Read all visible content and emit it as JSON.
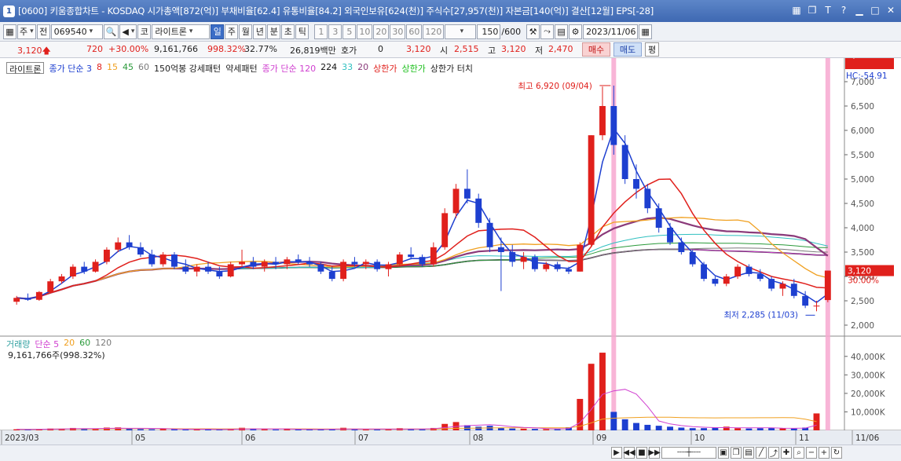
{
  "window": {
    "number": "1",
    "title": "[0600] 키움종합차트 - KOSDAQ 시가총액[872(억)] 부채비율[62.4] 유통비율[84.2] 외국인보유[624(천)] 주식수[27,957(천)] 자본금[140(억)] 결산[12월] EPS[-28]"
  },
  "toolbar": {
    "type_select": "주",
    "prev_label": "전",
    "stock_code": "069540",
    "stock_name": "라이트론",
    "stock_prefix": "코",
    "periods": [
      "일",
      "주",
      "월",
      "년",
      "분",
      "초",
      "틱"
    ],
    "active_period": "일",
    "intervals": [
      "1",
      "3",
      "5",
      "10",
      "20",
      "30",
      "60",
      "120"
    ],
    "count": "150",
    "count_total": "/600",
    "date": "2023/11/06"
  },
  "quote": {
    "price": "3,120",
    "change": "720",
    "change_pct": "+30.00%",
    "volume": "9,161,766",
    "volume_ratio": "998.32%",
    "turnover": "32.77%",
    "amount": "26,819백만",
    "hoga_label": "호가",
    "hoga_value": "0",
    "current": "3,120",
    "open_label": "시",
    "open": "2,515",
    "high_label": "고",
    "high": "3,120",
    "low_label": "저",
    "low": "2,470",
    "buy_label": "매수",
    "sell_label": "매도",
    "avg_label": "평"
  },
  "legend_price": {
    "name": "라이트론",
    "ma_label": "종가 단순",
    "ma_periods": [
      "3",
      "8",
      "15",
      "45",
      "60"
    ],
    "pattern_label": "150억봉 강세패턴",
    "weak_pattern": "약세패턴",
    "ma2_label": "종가 단순",
    "ma2_periods": [
      "120",
      "224",
      "33",
      "20"
    ],
    "upper_limit": "상한가",
    "upper_limit2": "상한가",
    "upper_touch": "상한가 터치"
  },
  "legend_volume": {
    "name": "거래량",
    "ma_label": "단순",
    "ma_periods": [
      "5",
      "20",
      "60",
      "120"
    ],
    "info": "9,161,766주(998.32%)"
  },
  "annotations": {
    "high": "최고 6,920 (09/04)",
    "low": "최저 2,285 (11/03)"
  },
  "right_axis": {
    "lc": "LC:36.54",
    "hc": "HC:-54.91",
    "price_ticks": [
      "7,000",
      "6,500",
      "6,000",
      "5,500",
      "5,000",
      "4,500",
      "4,000",
      "3,500",
      "3,000",
      "2,500",
      "2,000"
    ],
    "current_price": "3,120",
    "current_pct": "30.00%",
    "volume_ticks": [
      "40,000K",
      "30,000K",
      "20,000K",
      "10,000K"
    ],
    "current_volume": "9,162K",
    "current_volume_pct": "998.32%"
  },
  "x_axis": {
    "labels": [
      "2023/03",
      "05",
      "06",
      "07",
      "08",
      "09",
      "10",
      "11",
      "11/06"
    ]
  },
  "colors": {
    "up": "#e0201c",
    "down": "#1d3fd0",
    "ma3": "#1d3fd0",
    "ma8": "#e0201c",
    "ma15": "#f0a020",
    "ma45": "#2a9a3a",
    "ma60": "#7a7a7a",
    "ma120": "#d040d0",
    "ma224": "#111111",
    "ma33": "#30c0c0",
    "ma20": "#8a3a7a",
    "highlight": "#f7a8d0"
  },
  "chart_data": {
    "type": "candlestick",
    "price_range": [
      2000,
      7000
    ],
    "volume_range": [
      0,
      45000
    ],
    "candles": [
      {
        "o": 2480,
        "h": 2600,
        "l": 2420,
        "c": 2560
      },
      {
        "o": 2560,
        "h": 2650,
        "l": 2500,
        "c": 2520
      },
      {
        "o": 2520,
        "h": 2700,
        "l": 2500,
        "c": 2680
      },
      {
        "o": 2680,
        "h": 2950,
        "l": 2650,
        "c": 2900
      },
      {
        "o": 2900,
        "h": 3050,
        "l": 2850,
        "c": 3000
      },
      {
        "o": 3000,
        "h": 3250,
        "l": 2950,
        "c": 3200
      },
      {
        "o": 3200,
        "h": 3300,
        "l": 3050,
        "c": 3100
      },
      {
        "o": 3100,
        "h": 3350,
        "l": 3080,
        "c": 3300
      },
      {
        "o": 3300,
        "h": 3600,
        "l": 3250,
        "c": 3550
      },
      {
        "o": 3550,
        "h": 3800,
        "l": 3500,
        "c": 3700
      },
      {
        "o": 3700,
        "h": 3850,
        "l": 3550,
        "c": 3600
      },
      {
        "o": 3600,
        "h": 3700,
        "l": 3400,
        "c": 3450
      },
      {
        "o": 3450,
        "h": 3550,
        "l": 3200,
        "c": 3250
      },
      {
        "o": 3250,
        "h": 3500,
        "l": 3200,
        "c": 3450
      },
      {
        "o": 3450,
        "h": 3500,
        "l": 3150,
        "c": 3200
      },
      {
        "o": 3200,
        "h": 3350,
        "l": 3050,
        "c": 3100
      },
      {
        "o": 3100,
        "h": 3250,
        "l": 3000,
        "c": 3200
      },
      {
        "o": 3200,
        "h": 3300,
        "l": 3050,
        "c": 3100
      },
      {
        "o": 3100,
        "h": 3200,
        "l": 2950,
        "c": 3000
      },
      {
        "o": 3000,
        "h": 3300,
        "l": 2980,
        "c": 3250
      },
      {
        "o": 3250,
        "h": 3550,
        "l": 3200,
        "c": 3300
      },
      {
        "o": 3300,
        "h": 3400,
        "l": 3150,
        "c": 3200
      },
      {
        "o": 3200,
        "h": 3350,
        "l": 3100,
        "c": 3300
      },
      {
        "o": 3300,
        "h": 3400,
        "l": 3150,
        "c": 3250
      },
      {
        "o": 3250,
        "h": 3400,
        "l": 3150,
        "c": 3350
      },
      {
        "o": 3350,
        "h": 3450,
        "l": 3250,
        "c": 3300
      },
      {
        "o": 3300,
        "h": 3400,
        "l": 3200,
        "c": 3250
      },
      {
        "o": 3250,
        "h": 3300,
        "l": 3050,
        "c": 3100
      },
      {
        "o": 3100,
        "h": 3200,
        "l": 2900,
        "c": 2950
      },
      {
        "o": 2950,
        "h": 3350,
        "l": 2900,
        "c": 3300
      },
      {
        "o": 3300,
        "h": 3400,
        "l": 3200,
        "c": 3250
      },
      {
        "o": 3250,
        "h": 3350,
        "l": 3150,
        "c": 3300
      },
      {
        "o": 3300,
        "h": 3350,
        "l": 3100,
        "c": 3150
      },
      {
        "o": 3150,
        "h": 3300,
        "l": 3000,
        "c": 3250
      },
      {
        "o": 3250,
        "h": 3500,
        "l": 3200,
        "c": 3450
      },
      {
        "o": 3450,
        "h": 3600,
        "l": 3350,
        "c": 3400
      },
      {
        "o": 3400,
        "h": 3450,
        "l": 3200,
        "c": 3250
      },
      {
        "o": 3250,
        "h": 3700,
        "l": 3200,
        "c": 3600
      },
      {
        "o": 3600,
        "h": 4400,
        "l": 3550,
        "c": 4300
      },
      {
        "o": 4300,
        "h": 4900,
        "l": 4200,
        "c": 4800
      },
      {
        "o": 4800,
        "h": 5200,
        "l": 4500,
        "c": 4600
      },
      {
        "o": 4600,
        "h": 4700,
        "l": 4000,
        "c": 4100
      },
      {
        "o": 4100,
        "h": 4200,
        "l": 3500,
        "c": 3600
      },
      {
        "o": 3600,
        "h": 3800,
        "l": 2700,
        "c": 3500
      },
      {
        "o": 3500,
        "h": 3650,
        "l": 3200,
        "c": 3300
      },
      {
        "o": 3300,
        "h": 3500,
        "l": 3150,
        "c": 3400
      },
      {
        "o": 3400,
        "h": 3450,
        "l": 3100,
        "c": 3150
      },
      {
        "o": 3150,
        "h": 3300,
        "l": 3100,
        "c": 3250
      },
      {
        "o": 3250,
        "h": 3300,
        "l": 3100,
        "c": 3150
      },
      {
        "o": 3150,
        "h": 3200,
        "l": 3050,
        "c": 3100
      },
      {
        "o": 3100,
        "h": 3700,
        "l": 3100,
        "c": 3650
      },
      {
        "o": 3650,
        "h": 5900,
        "l": 3600,
        "c": 5900
      },
      {
        "o": 5900,
        "h": 6900,
        "l": 5800,
        "c": 6500
      },
      {
        "o": 6500,
        "h": 6920,
        "l": 5500,
        "c": 5700
      },
      {
        "o": 5700,
        "h": 5900,
        "l": 4900,
        "c": 5000
      },
      {
        "o": 5000,
        "h": 5300,
        "l": 4600,
        "c": 4800
      },
      {
        "o": 4800,
        "h": 4900,
        "l": 4300,
        "c": 4400
      },
      {
        "o": 4400,
        "h": 4500,
        "l": 3900,
        "c": 4000
      },
      {
        "o": 4000,
        "h": 4100,
        "l": 3650,
        "c": 3700
      },
      {
        "o": 3700,
        "h": 3800,
        "l": 3450,
        "c": 3500
      },
      {
        "o": 3500,
        "h": 3550,
        "l": 3200,
        "c": 3250
      },
      {
        "o": 3250,
        "h": 3300,
        "l": 2900,
        "c": 2950
      },
      {
        "o": 2950,
        "h": 3000,
        "l": 2800,
        "c": 2850
      },
      {
        "o": 2850,
        "h": 3050,
        "l": 2800,
        "c": 3000
      },
      {
        "o": 3000,
        "h": 3250,
        "l": 2950,
        "c": 3200
      },
      {
        "o": 3200,
        "h": 3250,
        "l": 3000,
        "c": 3050
      },
      {
        "o": 3050,
        "h": 3150,
        "l": 2900,
        "c": 2950
      },
      {
        "o": 2950,
        "h": 3000,
        "l": 2700,
        "c": 2750
      },
      {
        "o": 2750,
        "h": 2900,
        "l": 2600,
        "c": 2850
      },
      {
        "o": 2850,
        "h": 2950,
        "l": 2550,
        "c": 2600
      },
      {
        "o": 2600,
        "h": 2700,
        "l": 2350,
        "c": 2400
      },
      {
        "o": 2400,
        "h": 2500,
        "l": 2285,
        "c": 2400
      },
      {
        "o": 2515,
        "h": 3120,
        "l": 2470,
        "c": 3120
      }
    ],
    "volumes": [
      600,
      500,
      700,
      1000,
      900,
      1300,
      700,
      900,
      1500,
      1600,
      900,
      700,
      600,
      900,
      600,
      500,
      600,
      500,
      500,
      900,
      1400,
      700,
      600,
      500,
      800,
      600,
      500,
      500,
      700,
      1400,
      600,
      500,
      500,
      600,
      1200,
      800,
      600,
      1300,
      3500,
      4500,
      2800,
      2000,
      2500,
      1500,
      1000,
      900,
      800,
      700,
      600,
      1700,
      17000,
      36000,
      42000,
      10000,
      6000,
      4000,
      3000,
      2500,
      2000,
      1500,
      1200,
      1200,
      1500,
      2000,
      1200,
      1000,
      1200,
      1300,
      1100,
      1000,
      1500,
      9162
    ]
  }
}
